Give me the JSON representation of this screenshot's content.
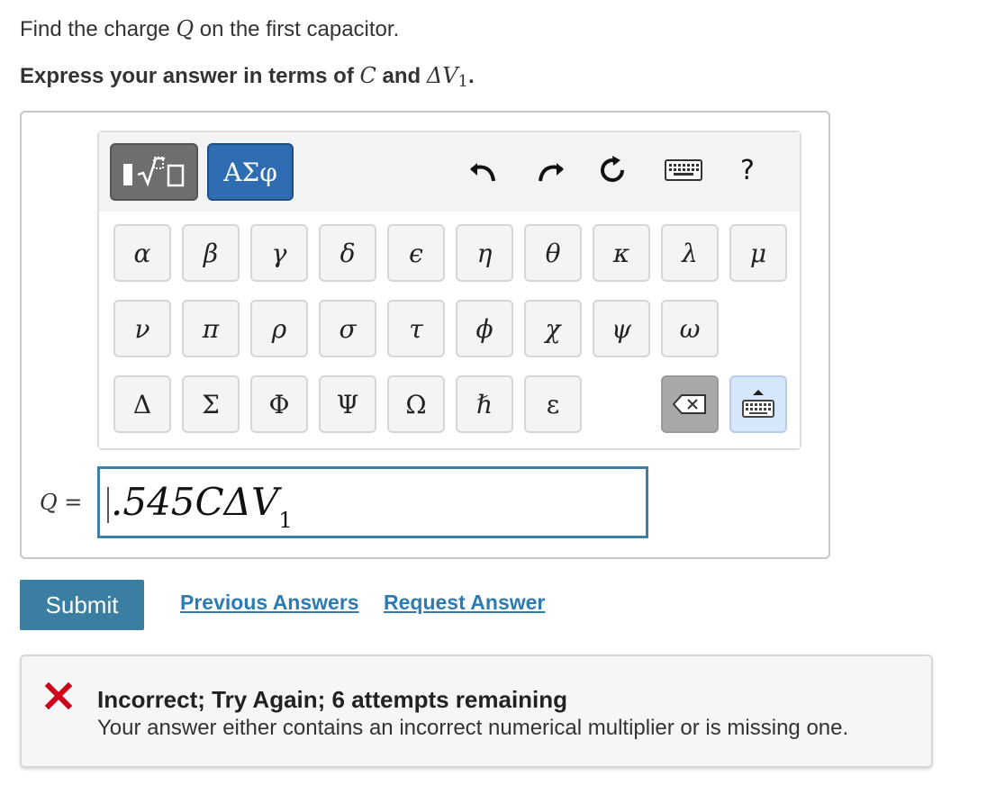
{
  "question": {
    "prompt_before": "Find the charge ",
    "prompt_var": "Q",
    "prompt_after": " on the first capacitor.",
    "instruction_before": "Express your answer in terms of ",
    "instruction_var1": "C",
    "instruction_mid": " and ",
    "instruction_var2": "ΔV",
    "instruction_sub": "1",
    "instruction_end": "."
  },
  "toolbar": {
    "template_mode_label": "▮√▢",
    "greek_mode_label": "ΑΣφ",
    "undo_icon": "undo-icon",
    "redo_icon": "redo-icon",
    "reset_icon": "reset-icon",
    "keyboard_icon": "keyboard-icon",
    "help_label": "?"
  },
  "keys": {
    "row1": [
      "α",
      "β",
      "γ",
      "δ",
      "ϵ",
      "η",
      "θ",
      "κ",
      "λ",
      "μ"
    ],
    "row2": [
      "ν",
      "π",
      "ρ",
      "σ",
      "τ",
      "ϕ",
      "χ",
      "ψ",
      "ω"
    ],
    "row3": [
      "Δ",
      "Σ",
      "Φ",
      "Ψ",
      "Ω",
      "ℏ",
      "ε"
    ],
    "backspace_label": "⌫",
    "keyboard_toggle_icon": "keyboard-toggle-icon"
  },
  "answer": {
    "variable_label": "Q =",
    "value": ".545CΔV",
    "value_sub": "1"
  },
  "actions": {
    "submit_label": "Submit",
    "previous_answers_label": "Previous Answers",
    "request_answer_label": "Request Answer"
  },
  "feedback": {
    "status_icon": "error-x-icon",
    "title": "Incorrect; Try Again; 6 attempts remaining",
    "message": "Your answer either contains an incorrect numerical multiplier or is missing one."
  },
  "colors": {
    "submit_bg": "#3a7ea1",
    "link": "#2c7bb2",
    "greek_mode_bg": "#2f6db3",
    "error": "#d0021b",
    "input_border": "#3d7fa6"
  }
}
